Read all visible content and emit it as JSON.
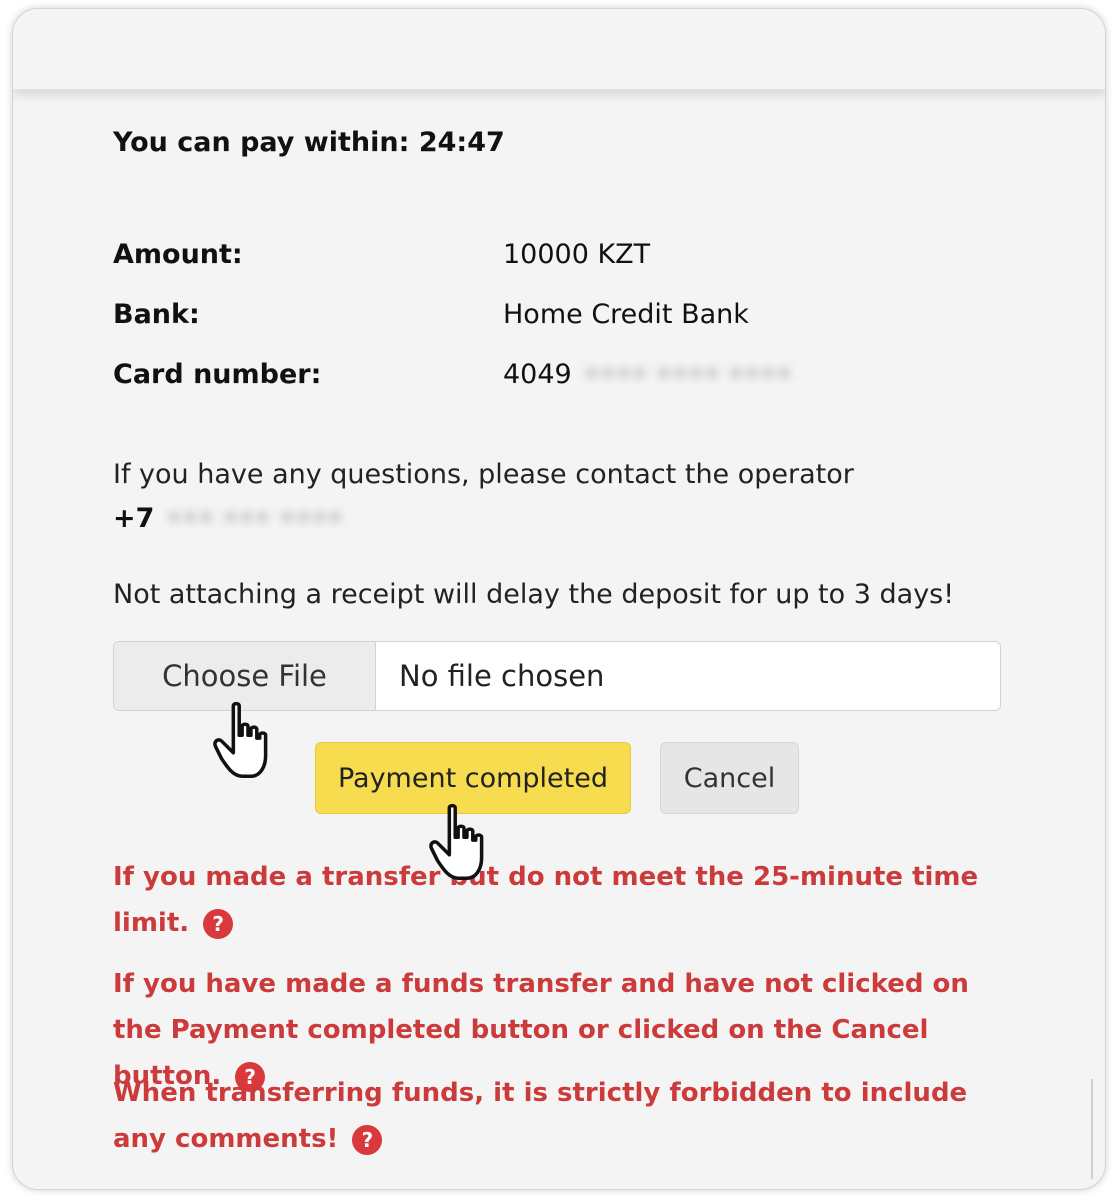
{
  "timer": {
    "label": "You can pay within:",
    "value": "24:47"
  },
  "details": {
    "amount_label": "Amount:",
    "amount_value": "10000 KZT",
    "bank_label": "Bank:",
    "bank_value": "Home Credit Bank",
    "card_label": "Card number:",
    "card_value": "4049"
  },
  "contact": {
    "text": "If you have any questions, please contact the operator",
    "phone": "+7"
  },
  "receipt_warning": "Not attaching a receipt will delay the deposit for up to 3 days!",
  "file_input": {
    "button_label": "Choose File",
    "status": "No file chosen"
  },
  "actions": {
    "pay_label": "Payment completed",
    "cancel_label": "Cancel"
  },
  "alerts": [
    {
      "text": "If you made a transfer but do not meet the 25-minute time limit."
    },
    {
      "text": "If you have made a funds transfer and have not clicked on the Payment completed button or clicked on the Cancel button."
    },
    {
      "text": "When transferring funds, it is strictly forbidden to include any comments!"
    }
  ],
  "colors": {
    "accent_yellow": "#f7dc4f",
    "alert_red": "#cc3b3b"
  },
  "icons": {
    "help": "question-circle-icon",
    "cursor": "hand-pointer-icon"
  }
}
